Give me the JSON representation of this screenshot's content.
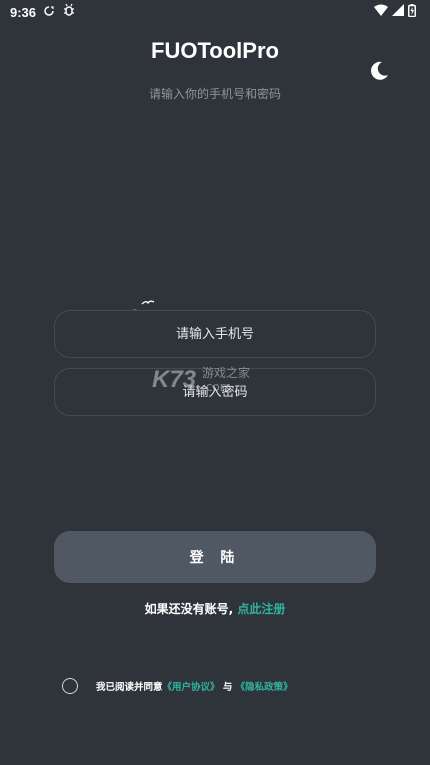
{
  "status_bar": {
    "time": "9:36",
    "icons": [
      "sync-icon",
      "bug-icon",
      "wifi-icon",
      "signal-icon",
      "battery-icon"
    ]
  },
  "header": {
    "title": "FUOToolPro",
    "subtitle": "请输入你的手机号和密码",
    "theme_icon": "moon-icon"
  },
  "form": {
    "phone_placeholder": "请输入手机号",
    "password_placeholder": "请输入密码",
    "login_label": "登 陆"
  },
  "register": {
    "prompt": "如果还没有账号, ",
    "link": "点此注册"
  },
  "agreement": {
    "prefix": "我已阅读并同意",
    "user_agreement": "《用户协议》",
    "joiner": " 与 ",
    "privacy_policy": "《隐私政策》"
  },
  "watermark": {
    "logo": "K73",
    "line1": "游戏之家",
    "line2": ".com"
  },
  "colors": {
    "background": "#2f343b",
    "accent": "#2fb3a0",
    "button": "#505864",
    "input_border": "#444a52"
  }
}
